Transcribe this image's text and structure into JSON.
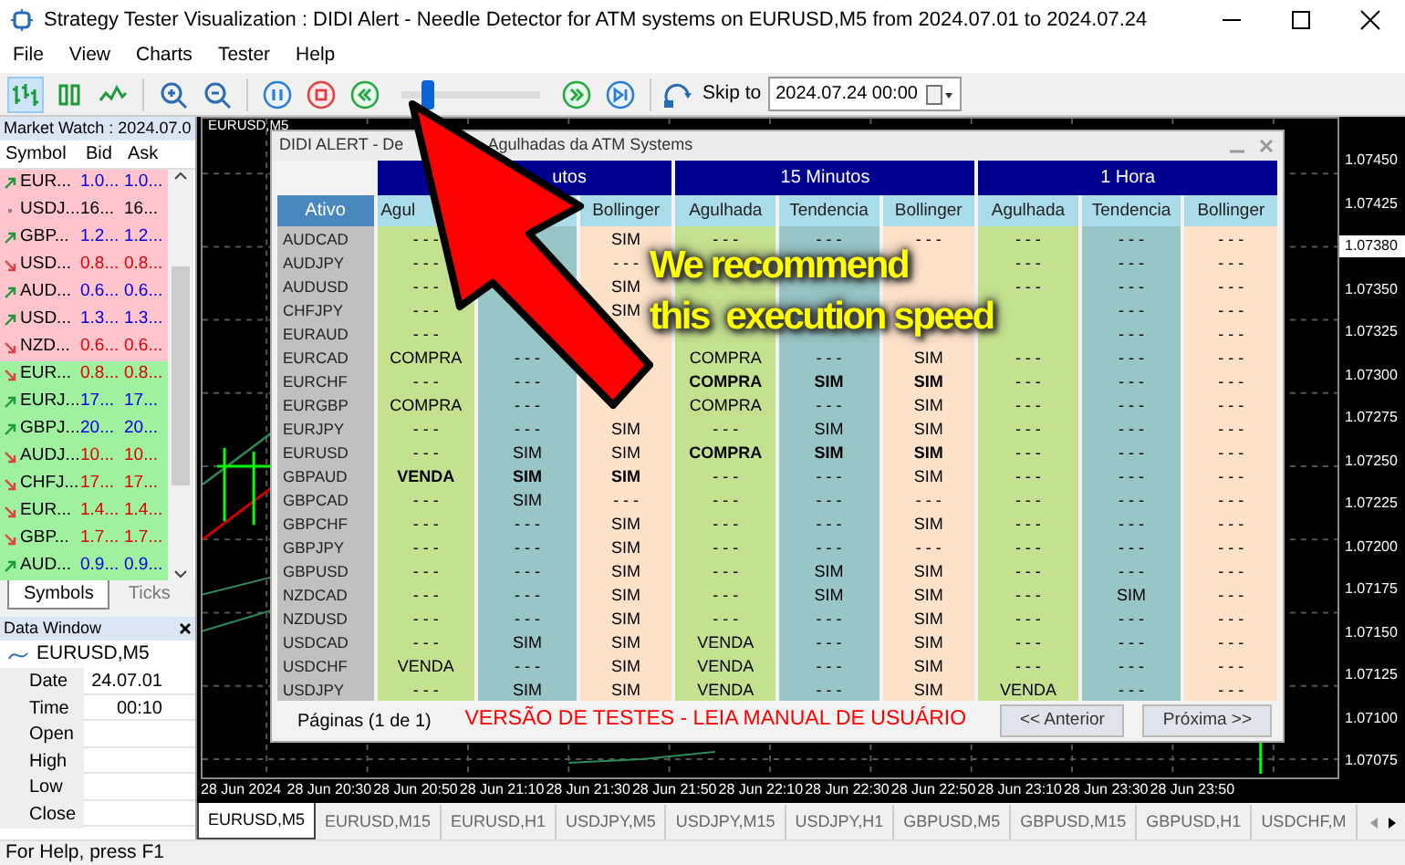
{
  "window": {
    "title": "Strategy Tester Visualization : DIDI Alert - Needle Detector for ATM systems on EURUSD,M5 from 2024.07.01 to 2024.07.24"
  },
  "menu": [
    "File",
    "View",
    "Charts",
    "Tester",
    "Help"
  ],
  "toolbar": {
    "speed": {
      "level": 0.15
    },
    "skip_label": "Skip to",
    "skip_value": "2024.07.24 00:00"
  },
  "market_watch": {
    "title": "Market Watch : 2024.07.0",
    "columns": [
      "Symbol",
      "Bid",
      "Ask"
    ],
    "rows": [
      {
        "symbol": "EUR...",
        "bid": "1.0...",
        "ask": "1.0...",
        "kind": "up",
        "color": "#ffc4cc"
      },
      {
        "symbol": "USDJ...",
        "bid": "16...",
        "ask": "16...",
        "kind": "flat",
        "color": "#ffc4cc"
      },
      {
        "symbol": "GBP...",
        "bid": "1.2...",
        "ask": "1.2...",
        "kind": "up",
        "color": "#ffc4cc"
      },
      {
        "symbol": "USD...",
        "bid": "0.8...",
        "ask": "0.8...",
        "kind": "down",
        "color": "#ffc4cc"
      },
      {
        "symbol": "AUD...",
        "bid": "0.6...",
        "ask": "0.6...",
        "kind": "up",
        "color": "#ffc4cc"
      },
      {
        "symbol": "USD...",
        "bid": "1.3...",
        "ask": "1.3...",
        "kind": "up",
        "color": "#ffc4cc"
      },
      {
        "symbol": "NZD...",
        "bid": "0.6...",
        "ask": "0.6...",
        "kind": "down",
        "color": "#ffc4cc"
      },
      {
        "symbol": "EUR...",
        "bid": "0.8...",
        "ask": "0.8...",
        "kind": "down",
        "color": "#9ff09f"
      },
      {
        "symbol": "EURJ...",
        "bid": "17...",
        "ask": "17...",
        "kind": "up",
        "color": "#9ff09f"
      },
      {
        "symbol": "GBPJ...",
        "bid": "20...",
        "ask": "20...",
        "kind": "up",
        "color": "#9ff09f"
      },
      {
        "symbol": "AUDJ...",
        "bid": "10...",
        "ask": "10...",
        "kind": "down",
        "color": "#9ff09f"
      },
      {
        "symbol": "CHFJ...",
        "bid": "17...",
        "ask": "17...",
        "kind": "down",
        "color": "#9ff09f"
      },
      {
        "symbol": "EUR...",
        "bid": "1.4...",
        "ask": "1.4...",
        "kind": "down",
        "color": "#9ff09f"
      },
      {
        "symbol": "GBP...",
        "bid": "1.7...",
        "ask": "1.7...",
        "kind": "down",
        "color": "#9ff09f"
      },
      {
        "symbol": "AUD...",
        "bid": "0.9...",
        "ask": "0.9...",
        "kind": "up",
        "color": "#9ff09f"
      }
    ],
    "tabs": [
      {
        "label": "Symbols",
        "selected": true
      },
      {
        "label": "Ticks",
        "selected": false
      }
    ]
  },
  "data_window": {
    "title": "Data Window",
    "series": "EURUSD,M5",
    "rows": [
      {
        "label": "Date",
        "value": "24.07.01"
      },
      {
        "label": "Time",
        "value": "00:10"
      },
      {
        "label": "Open"
      },
      {
        "label": "High"
      },
      {
        "label": "Low"
      },
      {
        "label": "Close"
      }
    ]
  },
  "chart": {
    "title": "EURUSD,M5",
    "price_labels": [
      "1.07450",
      "1.07425",
      "1.07350",
      "1.07325",
      "1.07300",
      "1.07275",
      "1.07250",
      "1.07225",
      "1.07200",
      "1.07175",
      "1.07150",
      "1.07125",
      "1.07100",
      "1.07075"
    ],
    "current_price": "1.07380",
    "time_labels": [
      "28 Jun 2024",
      "28 Jun 20:30",
      "28 Jun 20:50",
      "28 Jun 21:10",
      "28 Jun 21:30",
      "28 Jun 21:50",
      "28 Jun 22:10",
      "28 Jun 22:30",
      "28 Jun 22:50",
      "28 Jun 23:10",
      "28 Jun 23:30",
      "28 Jun 23:50"
    ]
  },
  "dialog": {
    "title_start": "DIDI ALERT - De",
    "title_end": "Agulhadas da ATM Systems",
    "groups": [
      "utos",
      "15 Minutos",
      "1 Hora"
    ],
    "columns": [
      "Ativo",
      "Agul",
      null,
      "Bollinger",
      "Agulhada",
      "Tendencia",
      "Bollinger",
      "Agulhada",
      "Tendencia",
      "Bollinger"
    ],
    "rows": [
      {
        "cells": [
          "AUDCAD",
          "- - -",
          null,
          "SIM",
          "- - -",
          "- - -",
          "- - -",
          "- - -",
          "- - -",
          "- - -"
        ]
      },
      {
        "cells": [
          "AUDJPY",
          "- - -",
          null,
          "- - -",
          null,
          null,
          null,
          "- - -",
          "- - -",
          "- - -"
        ]
      },
      {
        "cells": [
          "AUDUSD",
          "- - -",
          null,
          "SIM",
          null,
          null,
          null,
          "- - -",
          "- - -",
          "- - -"
        ]
      },
      {
        "cells": [
          "CHFJPY",
          "- - -",
          null,
          "SIM",
          null,
          null,
          null,
          null,
          "- - -",
          "- - -"
        ]
      },
      {
        "cells": [
          "EURAUD",
          "- - -",
          null,
          null,
          null,
          null,
          null,
          null,
          "- - -",
          "- - -"
        ]
      },
      {
        "cells": [
          "EURCAD",
          "COMPRA",
          "- - -",
          null,
          "COMPRA",
          "- - -",
          "SIM",
          "- - -",
          "- - -",
          "- - -"
        ]
      },
      {
        "cells": [
          "EURCHF",
          "- - -",
          "- - -",
          null,
          {
            "text": "COMPRA",
            "bold": true
          },
          {
            "text": "SIM",
            "bold": true
          },
          {
            "text": "SIM",
            "bold": true
          },
          "- - -",
          "- - -",
          "- - -"
        ]
      },
      {
        "cells": [
          "EURGBP",
          "COMPRA",
          "- - -",
          null,
          "COMPRA",
          "- - -",
          "SIM",
          "- - -",
          "- - -",
          "- - -"
        ]
      },
      {
        "cells": [
          "EURJPY",
          "- - -",
          "- - -",
          "SIM",
          "- - -",
          "SIM",
          "SIM",
          "- - -",
          "- - -",
          "- - -"
        ]
      },
      {
        "cells": [
          "EURUSD",
          "- - -",
          "SIM",
          "SIM",
          {
            "text": "COMPRA",
            "bold": true
          },
          {
            "text": "SIM",
            "bold": true
          },
          {
            "text": "SIM",
            "bold": true
          },
          "- - -",
          "- - -",
          "- - -"
        ]
      },
      {
        "cells": [
          "GBPAUD",
          {
            "text": "VENDA",
            "bold": true
          },
          {
            "text": "SIM",
            "bold": true
          },
          {
            "text": "SIM",
            "bold": true
          },
          "- - -",
          "- - -",
          "SIM",
          "- - -",
          "- - -",
          "- - -"
        ]
      },
      {
        "cells": [
          "GBPCAD",
          "- - -",
          "SIM",
          "- - -",
          "- - -",
          "- - -",
          "- - -",
          "- - -",
          "- - -",
          "- - -"
        ]
      },
      {
        "cells": [
          "GBPCHF",
          "- - -",
          "- - -",
          "SIM",
          "- - -",
          "- - -",
          "SIM",
          "- - -",
          "- - -",
          "- - -"
        ]
      },
      {
        "cells": [
          "GBPJPY",
          "- - -",
          "- - -",
          "SIM",
          "- - -",
          "- - -",
          "- - -",
          "- - -",
          "- - -",
          "- - -"
        ]
      },
      {
        "cells": [
          "GBPUSD",
          "- - -",
          "- - -",
          "SIM",
          "- - -",
          "SIM",
          "SIM",
          "- - -",
          "- - -",
          "- - -"
        ]
      },
      {
        "cells": [
          "NZDCAD",
          "- - -",
          "- - -",
          "SIM",
          "- - -",
          "SIM",
          "SIM",
          "- - -",
          "SIM",
          "- - -"
        ]
      },
      {
        "cells": [
          "NZDUSD",
          "- - -",
          "- - -",
          "SIM",
          "- - -",
          "- - -",
          "SIM",
          "- - -",
          "- - -",
          "- - -"
        ]
      },
      {
        "cells": [
          "USDCAD",
          "- - -",
          "SIM",
          "SIM",
          "VENDA",
          "- - -",
          "SIM",
          "- - -",
          "- - -",
          "- - -"
        ]
      },
      {
        "cells": [
          "USDCHF",
          "VENDA",
          "- - -",
          "SIM",
          "VENDA",
          "- - -",
          "SIM",
          "- - -",
          "- - -",
          "- - -"
        ]
      },
      {
        "cells": [
          "USDJPY",
          "- - -",
          "SIM",
          "SIM",
          "VENDA",
          "- - -",
          "SIM",
          "VENDA",
          "- - -",
          "- - -"
        ]
      }
    ],
    "pages": "Páginas (1 de 1)",
    "notice": "VERSÃO DE TESTES - LEIA MANUAL DE USUÁRIO",
    "buttons": [
      "<< Anterior",
      "Próxima >>"
    ]
  },
  "callout": {
    "lines": [
      "We recommend",
      "this  execution speed"
    ]
  },
  "chart_tabs": [
    {
      "label": "EURUSD,M5",
      "selected": true
    },
    {
      "label": "EURUSD,M15",
      "selected": false
    },
    {
      "label": "EURUSD,H1",
      "selected": false
    },
    {
      "label": "USDJPY,M5",
      "selected": false
    },
    {
      "label": "USDJPY,M15",
      "selected": false
    },
    {
      "label": "USDJPY,H1",
      "selected": false
    },
    {
      "label": "GBPUSD,M5",
      "selected": false
    },
    {
      "label": "GBPUSD,M15",
      "selected": false
    },
    {
      "label": "GBPUSD,H1",
      "selected": false
    },
    {
      "label": "USDCHF,M",
      "selected": false
    }
  ],
  "status_bar": "For Help, press F1"
}
